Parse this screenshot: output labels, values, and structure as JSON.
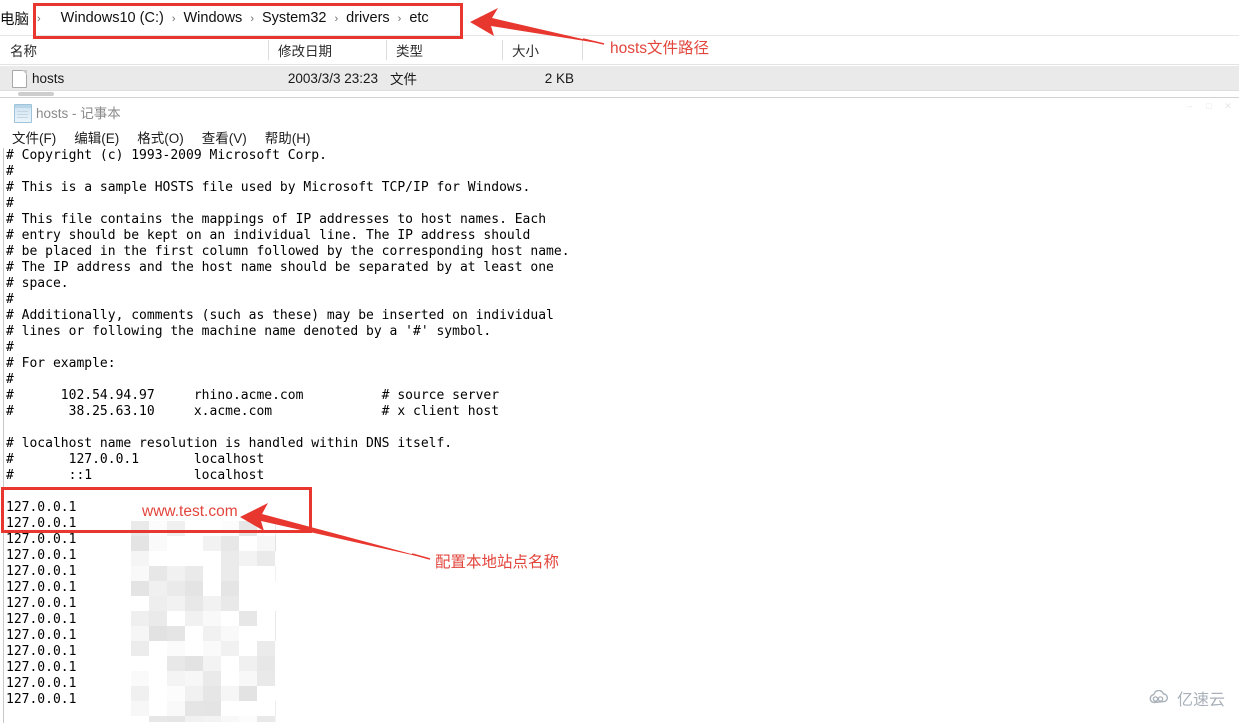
{
  "explorer": {
    "breadcrumb": {
      "name": "address-breadcrumb",
      "items": [
        "电脑",
        "Windows10 (C:)",
        "Windows",
        "System32",
        "drivers",
        "etc"
      ],
      "separator": "›"
    },
    "columns": [
      {
        "label": "名称",
        "key": "name"
      },
      {
        "label": "修改日期",
        "key": "modified"
      },
      {
        "label": "类型",
        "key": "type"
      },
      {
        "label": "大小",
        "key": "size"
      }
    ],
    "rows": [
      {
        "name": "hosts",
        "modified": "2003/3/3 23:23",
        "type": "文件",
        "size": "2 KB"
      }
    ]
  },
  "notepad": {
    "title": "hosts - 记事本",
    "window_controls": [
      "–",
      "□",
      "✕"
    ],
    "menu": [
      "文件(F)",
      "编辑(E)",
      "格式(O)",
      "查看(V)",
      "帮助(H)"
    ],
    "content": "# Copyright (c) 1993-2009 Microsoft Corp.\n#\n# This is a sample HOSTS file used by Microsoft TCP/IP for Windows.\n#\n# This file contains the mappings of IP addresses to host names. Each\n# entry should be kept on an individual line. The IP address should\n# be placed in the first column followed by the corresponding host name.\n# The IP address and the host name should be separated by at least one\n# space.\n#\n# Additionally, comments (such as these) may be inserted on individual\n# lines or following the machine name denoted by a '#' symbol.\n#\n# For example:\n#\n#      102.54.94.97     rhino.acme.com          # source server\n#       38.25.63.10     x.acme.com              # x client host\n\n# localhost name resolution is handled within DNS itself.\n#       127.0.0.1       localhost\n#       ::1             localhost\n\n127.0.0.1\n127.0.0.1\n127.0.0.1\n127.0.0.1\n127.0.0.1\n127.0.0.1\n127.0.0.1\n127.0.0.1\n127.0.0.1\n127.0.0.1\n127.0.0.1\n127.0.0.1\n127.0.0.1"
  },
  "annotations": {
    "color": "#e8372f",
    "path_label": "hosts文件路径",
    "site_label": "配置本地站点名称",
    "host_sample": "www.test.com"
  },
  "watermark": {
    "text": "亿速云"
  }
}
